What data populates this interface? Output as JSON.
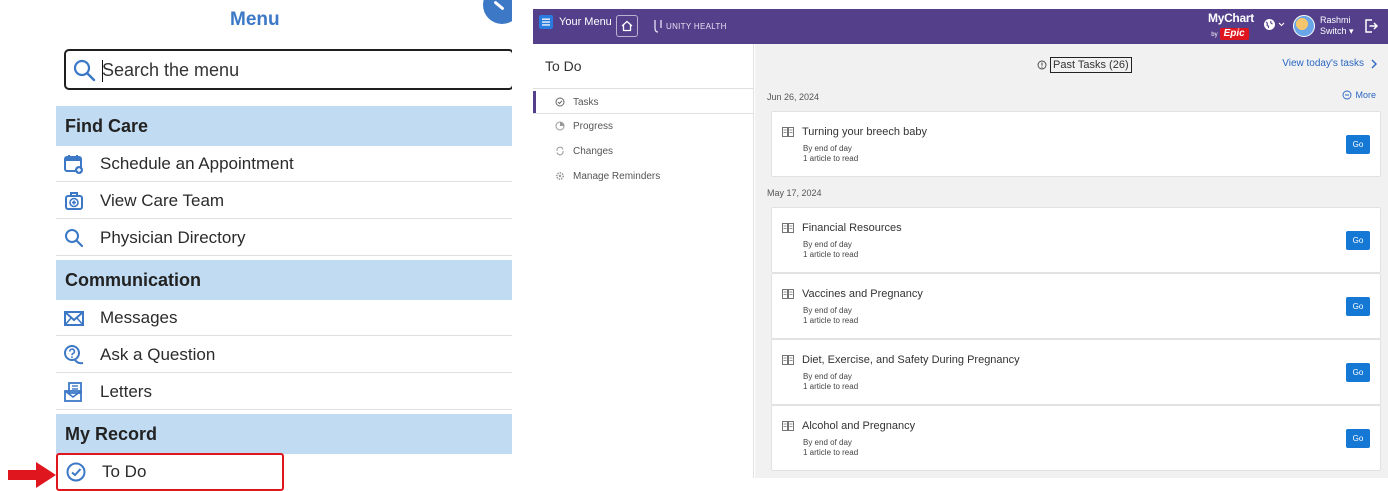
{
  "left_menu": {
    "title": "Menu",
    "search": {
      "placeholder": "Search the menu",
      "value": ""
    },
    "sections": [
      {
        "heading": "Find Care",
        "items": [
          {
            "label": "Schedule an Appointment",
            "icon": "calendar-plus-icon"
          },
          {
            "label": "View Care Team",
            "icon": "medical-bag-icon"
          },
          {
            "label": "Physician Directory",
            "icon": "search-icon"
          }
        ]
      },
      {
        "heading": "Communication",
        "items": [
          {
            "label": "Messages",
            "icon": "envelope-icon"
          },
          {
            "label": "Ask a Question",
            "icon": "question-bubble-icon"
          },
          {
            "label": "Letters",
            "icon": "letter-icon"
          }
        ]
      },
      {
        "heading": "My Record",
        "items": [
          {
            "label": "To Do",
            "icon": "clock-check-icon",
            "highlighted": true
          }
        ]
      }
    ],
    "accent_color": "#3c78c6",
    "section_color": "#c1dcf2",
    "highlight_color": "#e0161e"
  },
  "mychart": {
    "topbar": {
      "menu_label": "Your Menu",
      "org_logo": "UNITY HEALTH",
      "brand": "MyChart",
      "brand_by": "by",
      "brand_epic": "Epic",
      "user_first": "Rashmi",
      "user_second": "Switch",
      "color": "#533f8a"
    },
    "nav": {
      "heading": "To Do",
      "items": [
        {
          "label": "Tasks",
          "icon": "check-circle-icon",
          "active": true
        },
        {
          "label": "Progress",
          "icon": "progress-icon"
        },
        {
          "label": "Changes",
          "icon": "changes-icon"
        },
        {
          "label": "Manage Reminders",
          "icon": "gear-icon"
        }
      ]
    },
    "main": {
      "past_tasks_label": "Past Tasks (26)",
      "view_today_label": "View today's tasks",
      "more_label": "More",
      "groups": [
        {
          "date": "Jun 26, 2024",
          "tasks": [
            {
              "title": "Turning your breech baby",
              "due": "By end of day",
              "detail": "1 article to read",
              "action": "Go"
            }
          ]
        },
        {
          "date": "May 17, 2024",
          "tasks": [
            {
              "title": "Financial Resources",
              "due": "By end of day",
              "detail": "1 article to read",
              "action": "Go"
            },
            {
              "title": "Vaccines and Pregnancy",
              "due": "By end of day",
              "detail": "1 article to read",
              "action": "Go"
            },
            {
              "title": "Diet, Exercise, and Safety During Pregnancy",
              "due": "By end of day",
              "detail": "1 article to read",
              "action": "Go"
            },
            {
              "title": "Alcohol and Pregnancy",
              "due": "By end of day",
              "detail": "1 article to read",
              "action": "Go"
            }
          ]
        }
      ],
      "button_color": "#1578d5",
      "link_color": "#2a66c4"
    }
  }
}
